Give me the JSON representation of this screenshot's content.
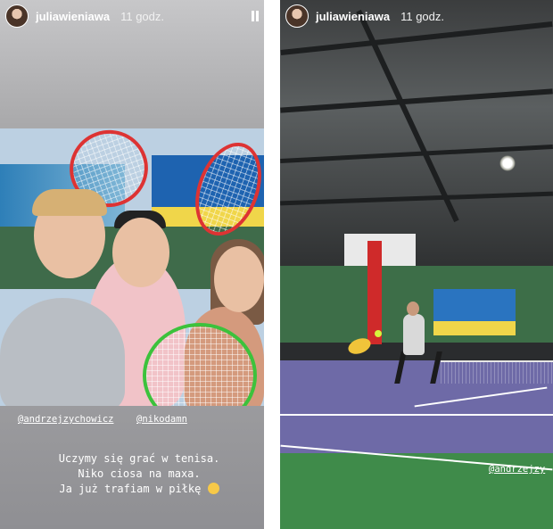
{
  "left_story": {
    "username": "juliawieniawa",
    "time": "11 godz.",
    "mentions": [
      "@andrzejzychowicz",
      "@nikodamn"
    ],
    "caption_lines": [
      "Uczymy się grać w tenisa.",
      "Niko ciosa na maxa.",
      "Ja już trafiam w piłkę"
    ],
    "caption_emoji": "face-with-tears-of-joy-emoji"
  },
  "right_story": {
    "username": "juliawieniawa",
    "time": "11 godz.",
    "mention": "@andrzejzy"
  },
  "icons": {
    "avatar": "profile-avatar",
    "pause": "pause-icon"
  },
  "colors": {
    "text": "#ffffff",
    "left_background": "#9b9b9e",
    "court_purple": "#6e6aa7",
    "court_green": "#3f8b4a"
  }
}
